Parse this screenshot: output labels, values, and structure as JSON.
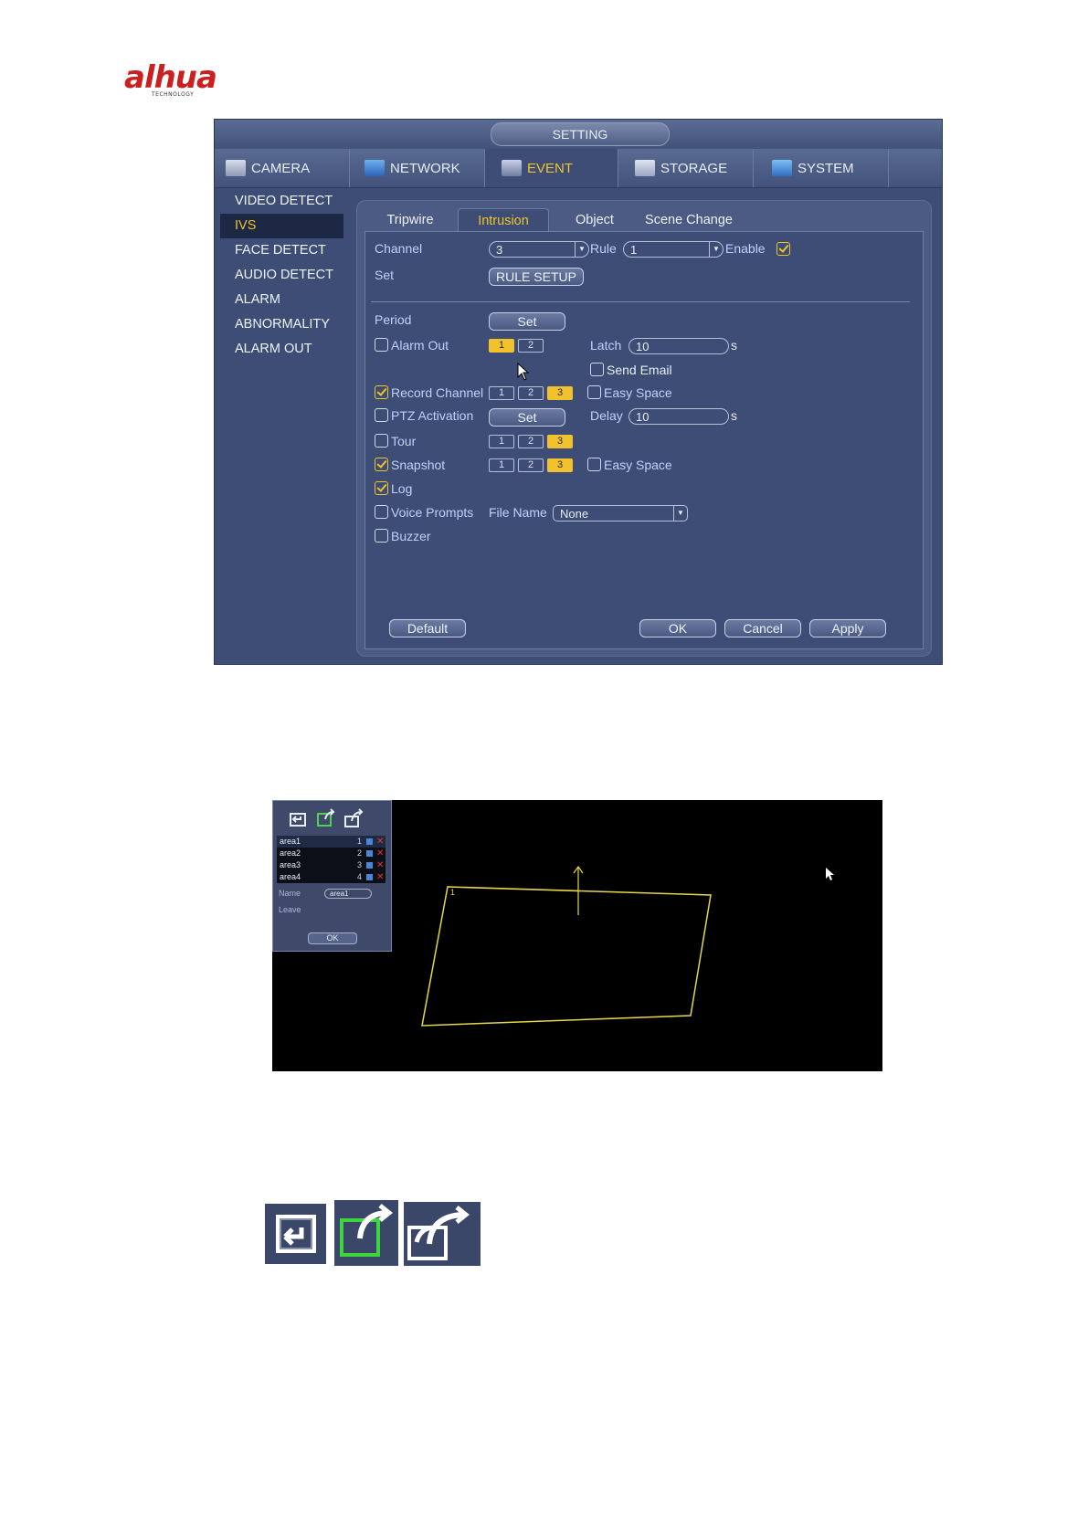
{
  "logo": {
    "brand": "alhua",
    "tagline": "TECHNOLOGY"
  },
  "window": {
    "title": "SETTING",
    "tabs": [
      {
        "label": "CAMERA"
      },
      {
        "label": "NETWORK"
      },
      {
        "label": "EVENT"
      },
      {
        "label": "STORAGE"
      },
      {
        "label": "SYSTEM"
      }
    ],
    "active_tab": "EVENT",
    "sidebar": [
      {
        "label": "VIDEO DETECT"
      },
      {
        "label": "IVS"
      },
      {
        "label": "FACE DETECT"
      },
      {
        "label": "AUDIO DETECT"
      },
      {
        "label": "ALARM"
      },
      {
        "label": "ABNORMALITY"
      },
      {
        "label": "ALARM OUT"
      }
    ],
    "active_sidebar": "IVS",
    "subtabs": [
      {
        "label": "Tripwire"
      },
      {
        "label": "Intrusion"
      },
      {
        "label": "Object"
      },
      {
        "label": "Scene Change"
      }
    ],
    "active_subtab": "Intrusion"
  },
  "form": {
    "channel_label": "Channel",
    "channel_value": "3",
    "rule_label": "Rule",
    "rule_value": "1",
    "enable_label": "Enable",
    "enable_checked": true,
    "set_label": "Set",
    "rule_setup_button": "RULE SETUP",
    "period_label": "Period",
    "period_button": "Set",
    "alarm_out_label": "Alarm Out",
    "alarm_out_checked": false,
    "alarm_out_channels": [
      "1",
      "2"
    ],
    "alarm_out_selected": [
      "1"
    ],
    "latch_label": "Latch",
    "latch_value": "10",
    "latch_unit": "s",
    "send_email_label": "Send Email",
    "send_email_checked": false,
    "record_channel_label": "Record Channel",
    "record_channel_checked": true,
    "record_channels": [
      "1",
      "2",
      "3"
    ],
    "record_selected": [
      "3"
    ],
    "easy_space_label": "Easy Space",
    "record_easy_space_checked": false,
    "ptz_label": "PTZ Activation",
    "ptz_checked": false,
    "ptz_button": "Set",
    "delay_label": "Delay",
    "delay_value": "10",
    "delay_unit": "s",
    "tour_label": "Tour",
    "tour_checked": false,
    "tour_channels": [
      "1",
      "2",
      "3"
    ],
    "tour_selected": [
      "3"
    ],
    "snapshot_label": "Snapshot",
    "snapshot_checked": true,
    "snapshot_channels": [
      "1",
      "2",
      "3"
    ],
    "snapshot_selected": [
      "3"
    ],
    "snapshot_easy_space_checked": false,
    "log_label": "Log",
    "log_checked": true,
    "voice_label": "Voice Prompts",
    "voice_checked": false,
    "file_name_label": "File Name",
    "file_name_value": "None",
    "buzzer_label": "Buzzer",
    "buzzer_checked": false
  },
  "footer": {
    "default_button": "Default",
    "ok_button": "OK",
    "cancel_button": "Cancel",
    "apply_button": "Apply"
  },
  "rule_screen": {
    "areas": [
      {
        "name": "area1",
        "no": "1"
      },
      {
        "name": "area2",
        "no": "2"
      },
      {
        "name": "area3",
        "no": "3"
      },
      {
        "name": "area4",
        "no": "4"
      }
    ],
    "name_label": "Name",
    "name_value": "area1",
    "leave_label": "Leave",
    "ok_button": "OK",
    "region_label": "1",
    "region_color": "#e6d84a"
  },
  "colors": {
    "accent": "#f2c22c",
    "window_bg": "#3d4d75",
    "label_blue": "#bfd0ff"
  },
  "icons": [
    "enter-icon",
    "exit-icon",
    "enter-exit-icon"
  ]
}
